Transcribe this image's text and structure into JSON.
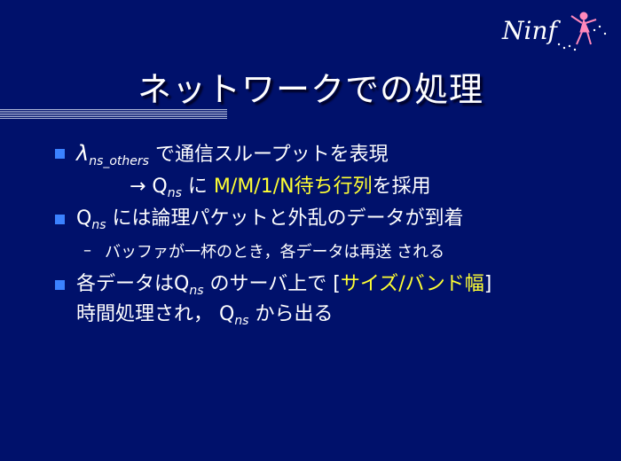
{
  "logo": {
    "text": "Ninf"
  },
  "title": "ネットワークでの処理",
  "bullets": [
    {
      "lambda": "λ",
      "sub": "ns_others",
      "text": " で通信スループットを表現"
    },
    {
      "arrow": "→ Q",
      "sub": "ns",
      "text1": " に ",
      "highlight": "M/M/1/N待ち行列",
      "text2": "を採用"
    },
    {
      "pre": "Q",
      "sub": "ns",
      "text": " には論理パケットと外乱のデータが到着"
    },
    {
      "dash": "–",
      "text": "バッファが一杯のとき，各データは再送 される"
    },
    {
      "pre": "各データはQ",
      "sub": "ns",
      "text1": " のサーバ上で [",
      "highlight": "サイズ/バンド幅",
      "text2": "]"
    },
    {
      "pre": "時間処理され，  Q",
      "sub": "ns",
      "text": " から出る"
    }
  ],
  "colors": {
    "background": "#00116b",
    "bullet": "#3b82ff",
    "highlight": "#ffff33"
  }
}
